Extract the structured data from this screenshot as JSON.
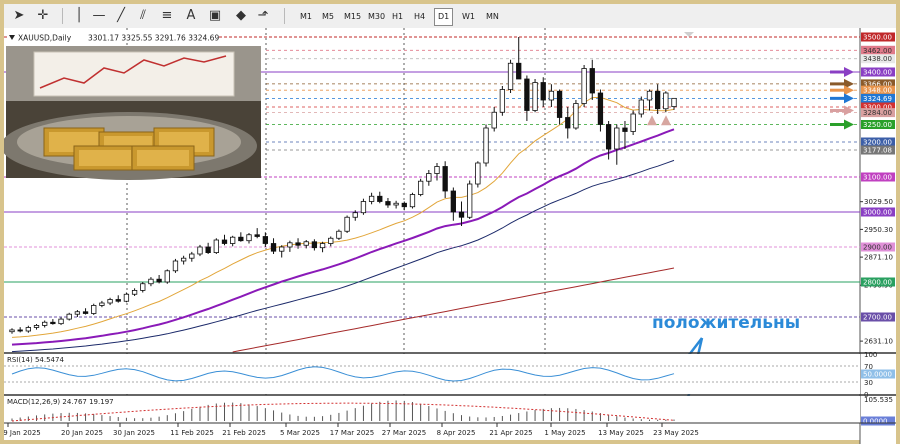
{
  "toolbar": {
    "timeframes": [
      "M1",
      "M5",
      "M15",
      "M30",
      "H1",
      "H4",
      "D1",
      "W1",
      "MN"
    ],
    "active_timeframe": "D1"
  },
  "chart_data": {
    "type": "candlestick",
    "symbol_label": "XAUUSD,Daily",
    "ohlc_label": "3301.17 3325.55 3291.76 3324.69",
    "ylim": [
      2600,
      3520
    ],
    "price_ticks": [
      "3029.50",
      "2950.30",
      "2871.10",
      "2790.90",
      "2631.10"
    ],
    "level_tags": [
      {
        "value": 3500,
        "label": "3500.00",
        "color": "#c0282a"
      },
      {
        "value": 3462,
        "label": "3462.00",
        "color": "#e07a8a"
      },
      {
        "value": 3438,
        "label": "3438.00",
        "color": "#e8e8e8"
      },
      {
        "value": 3400,
        "label": "3400.00",
        "color": "#8a3fc4"
      },
      {
        "value": 3366,
        "label": "3366.00",
        "color": "#8a5a2a"
      },
      {
        "value": 3348,
        "label": "3348.00",
        "color": "#e8944c"
      },
      {
        "value": 3324.69,
        "label": "3324.69",
        "color": "#1f77d4"
      },
      {
        "value": 3300,
        "label": "3300.00",
        "color": "#d23030"
      },
      {
        "value": 3284,
        "label": "3284.00",
        "color": "#d9a0a0"
      },
      {
        "value": 3250,
        "label": "3250.00",
        "color": "#2aa02a"
      },
      {
        "value": 3200,
        "label": "3200.00",
        "color": "#3c5fa8"
      },
      {
        "value": 3177.08,
        "label": "3177.08",
        "color": "#777777"
      },
      {
        "value": 3100,
        "label": "3100.00",
        "color": "#c040c0"
      },
      {
        "value": 3000,
        "label": "3000.00",
        "color": "#8a3fc4"
      },
      {
        "value": 2900,
        "label": "2900.00",
        "color": "#e090d8"
      },
      {
        "value": 2800,
        "label": "2800.00",
        "color": "#2aa060"
      },
      {
        "value": 2700,
        "label": "2700.00",
        "color": "#6a4fa8"
      }
    ],
    "date_labels": [
      "9 Jan 2025",
      "20 Jan 2025",
      "30 Jan 2025",
      "11 Feb 2025",
      "21 Feb 2025",
      "5 Mar 2025",
      "17 Mar 2025",
      "27 Mar 2025",
      "8 Apr 2025",
      "21 Apr 2025",
      "1 May 2025",
      "13 May 2025",
      "23 May 2025"
    ],
    "candles": [
      [
        2658,
        2668,
        2652,
        2663
      ],
      [
        2663,
        2671,
        2656,
        2660
      ],
      [
        2660,
        2675,
        2655,
        2670
      ],
      [
        2670,
        2680,
        2664,
        2676
      ],
      [
        2676,
        2690,
        2670,
        2685
      ],
      [
        2685,
        2694,
        2678,
        2681
      ],
      [
        2681,
        2699,
        2677,
        2694
      ],
      [
        2694,
        2712,
        2690,
        2708
      ],
      [
        2708,
        2720,
        2700,
        2715
      ],
      [
        2715,
        2725,
        2707,
        2710
      ],
      [
        2710,
        2738,
        2706,
        2733
      ],
      [
        2733,
        2746,
        2728,
        2740
      ],
      [
        2740,
        2755,
        2734,
        2750
      ],
      [
        2750,
        2762,
        2741,
        2745
      ],
      [
        2745,
        2770,
        2742,
        2765
      ],
      [
        2765,
        2782,
        2760,
        2776
      ],
      [
        2776,
        2800,
        2770,
        2795
      ],
      [
        2795,
        2814,
        2788,
        2808
      ],
      [
        2808,
        2820,
        2796,
        2800
      ],
      [
        2800,
        2836,
        2795,
        2832
      ],
      [
        2832,
        2866,
        2826,
        2860
      ],
      [
        2860,
        2875,
        2850,
        2868
      ],
      [
        2868,
        2886,
        2858,
        2880
      ],
      [
        2880,
        2906,
        2874,
        2900
      ],
      [
        2900,
        2912,
        2880,
        2884
      ],
      [
        2884,
        2925,
        2880,
        2920
      ],
      [
        2920,
        2935,
        2905,
        2910
      ],
      [
        2910,
        2932,
        2902,
        2928
      ],
      [
        2928,
        2942,
        2915,
        2918
      ],
      [
        2918,
        2940,
        2910,
        2935
      ],
      [
        2935,
        2954,
        2925,
        2930
      ],
      [
        2930,
        2942,
        2900,
        2910
      ],
      [
        2910,
        2925,
        2880,
        2888
      ],
      [
        2888,
        2905,
        2870,
        2900
      ],
      [
        2900,
        2918,
        2886,
        2912
      ],
      [
        2912,
        2925,
        2895,
        2905
      ],
      [
        2905,
        2920,
        2896,
        2915
      ],
      [
        2915,
        2922,
        2890,
        2898
      ],
      [
        2898,
        2915,
        2885,
        2910
      ],
      [
        2910,
        2930,
        2902,
        2925
      ],
      [
        2925,
        2950,
        2920,
        2945
      ],
      [
        2945,
        2990,
        2940,
        2985
      ],
      [
        2985,
        3005,
        2975,
        2998
      ],
      [
        2998,
        3038,
        2992,
        3030
      ],
      [
        3030,
        3055,
        3022,
        3045
      ],
      [
        3045,
        3058,
        3025,
        3030
      ],
      [
        3030,
        3040,
        3012,
        3020
      ],
      [
        3020,
        3032,
        3010,
        3025
      ],
      [
        3025,
        3030,
        3005,
        3015
      ],
      [
        3015,
        3055,
        3010,
        3050
      ],
      [
        3050,
        3095,
        3045,
        3088
      ],
      [
        3088,
        3120,
        3075,
        3110
      ],
      [
        3110,
        3140,
        3090,
        3130
      ],
      [
        3130,
        3145,
        3040,
        3060
      ],
      [
        3060,
        3070,
        2975,
        3000
      ],
      [
        3000,
        3030,
        2960,
        2985
      ],
      [
        2985,
        3090,
        2980,
        3080
      ],
      [
        3080,
        3145,
        3070,
        3140
      ],
      [
        3140,
        3250,
        3130,
        3240
      ],
      [
        3240,
        3300,
        3230,
        3285
      ],
      [
        3285,
        3360,
        3275,
        3350
      ],
      [
        3350,
        3435,
        3340,
        3425
      ],
      [
        3425,
        3500,
        3380,
        3380
      ],
      [
        3380,
        3390,
        3260,
        3290
      ],
      [
        3290,
        3380,
        3285,
        3370
      ],
      [
        3370,
        3385,
        3300,
        3320
      ],
      [
        3320,
        3365,
        3300,
        3345
      ],
      [
        3345,
        3350,
        3250,
        3270
      ],
      [
        3270,
        3300,
        3210,
        3240
      ],
      [
        3240,
        3320,
        3235,
        3310
      ],
      [
        3310,
        3420,
        3300,
        3410
      ],
      [
        3410,
        3435,
        3320,
        3340
      ],
      [
        3340,
        3350,
        3230,
        3250
      ],
      [
        3250,
        3260,
        3150,
        3180
      ],
      [
        3180,
        3250,
        3135,
        3240
      ],
      [
        3240,
        3260,
        3180,
        3230
      ],
      [
        3230,
        3290,
        3220,
        3280
      ],
      [
        3280,
        3330,
        3270,
        3320
      ],
      [
        3320,
        3350,
        3290,
        3345
      ],
      [
        3345,
        3365,
        3280,
        3295
      ],
      [
        3295,
        3345,
        3285,
        3340
      ],
      [
        3301.17,
        3325.55,
        3291.76,
        3324.69
      ]
    ],
    "arrows": [
      {
        "value": 3400,
        "color": "#8a3fc4"
      },
      {
        "value": 3366,
        "color": "#8a5a2a"
      },
      {
        "value": 3348,
        "color": "#e8944c"
      },
      {
        "value": 3324.69,
        "color": "#1f77d4"
      },
      {
        "value": 3290,
        "color": "#d9a0a0"
      },
      {
        "value": 3250,
        "color": "#2aa02a"
      }
    ],
    "annotation": "положительны",
    "rsi": {
      "label": "RSI(14) 54.5474",
      "ticks": [
        "100",
        "70",
        "30",
        "0"
      ],
      "level_tag": "50.0000"
    },
    "macd": {
      "label": "MACD(12,26,9) 24.767 19.197",
      "top_tick": "105.535",
      "level_tag": "0.0000"
    }
  }
}
